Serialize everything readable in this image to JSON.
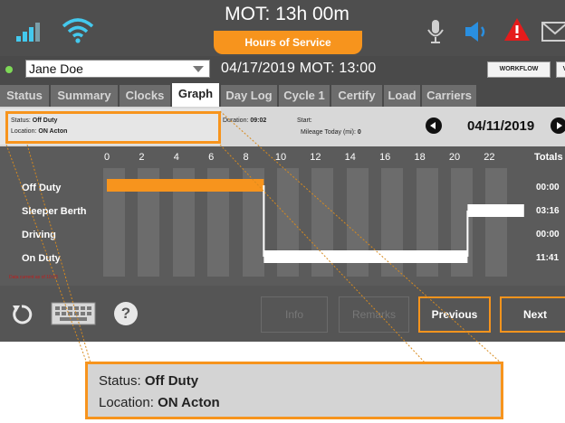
{
  "header": {
    "mot_time": "MOT: 13h 00m",
    "hos_label": "Hours of Service"
  },
  "driver": {
    "name": "Jane Doe",
    "date_mot": "04/17/2019  MOT: 13:00",
    "workflow_label": "WORKFLOW",
    "v_label": "V"
  },
  "tabs": [
    {
      "label": "Status"
    },
    {
      "label": "Summary"
    },
    {
      "label": "Clocks"
    },
    {
      "label": "Graph"
    },
    {
      "label": "Day Log"
    },
    {
      "label": "Cycle 1"
    },
    {
      "label": "Certify"
    },
    {
      "label": "Load"
    },
    {
      "label": "Carriers"
    }
  ],
  "info": {
    "status_label": "Status:",
    "status_value": "Off Duty",
    "location_label": "Location:",
    "location_value": "ON Acton",
    "duration_label": "Duration:",
    "duration_value": "09:02",
    "start_label": "Start:",
    "mileage_label": "Mileage Today (mi):",
    "mileage_value": "0",
    "log_date": "04/11/2019"
  },
  "graph": {
    "hours": [
      "0",
      "2",
      "4",
      "6",
      "8",
      "10",
      "12",
      "14",
      "16",
      "18",
      "20",
      "22"
    ],
    "totals_label": "Totals",
    "rows": [
      {
        "label": "Off Duty",
        "total": "00:00"
      },
      {
        "label": "Sleeper Berth",
        "total": "03:16"
      },
      {
        "label": "Driving",
        "total": "00:00"
      },
      {
        "label": "On Duty",
        "total": "11:41"
      }
    ],
    "red_note": "Data current as of 10:03",
    "segments": [
      {
        "status": "Off Duty",
        "start_hr": 0.0,
        "end_hr": 9.03
      },
      {
        "status": "On Duty",
        "start_hr": 9.03,
        "end_hr": 20.75
      },
      {
        "status": "Sleeper Berth",
        "start_hr": 20.75,
        "end_hr": 24.0
      }
    ],
    "colors": {
      "off_duty": "#f7941d",
      "duty": "#ffffff"
    }
  },
  "footer": {
    "info_label": "Info",
    "remarks_label": "Remarks",
    "previous_label": "Previous",
    "next_label": "Next"
  },
  "zoom": {
    "status_label": "Status:",
    "status_value": "Off Duty",
    "location_label": "Location:",
    "location_value": "ON Acton"
  }
}
